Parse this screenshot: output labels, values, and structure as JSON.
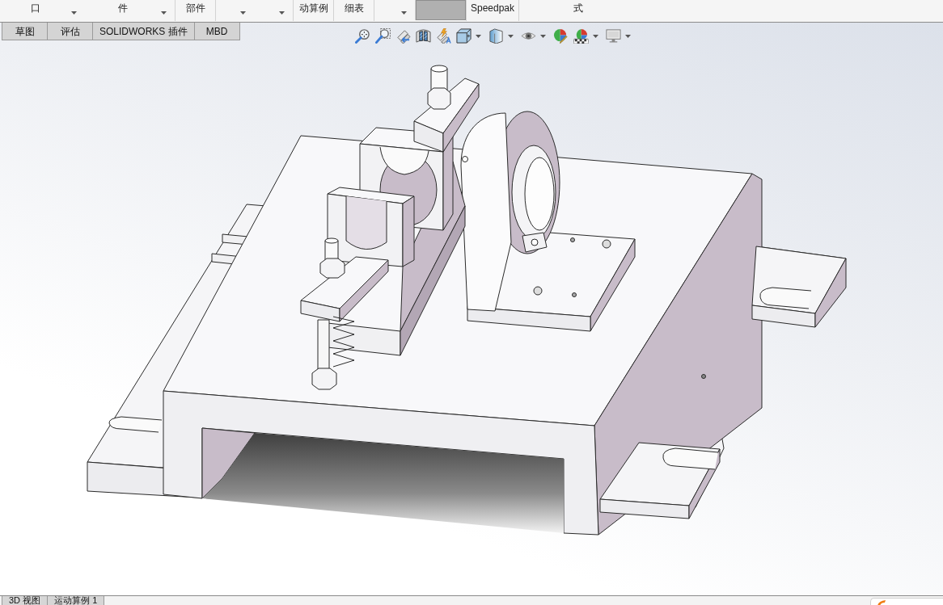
{
  "command_manager": {
    "groups": [
      {
        "items": [
          {
            "kind": "command",
            "label": "口",
            "menu": true
          },
          {
            "kind": "command",
            "label": "件",
            "menu": true
          }
        ]
      },
      {
        "items": [
          {
            "kind": "command",
            "label": "部件"
          }
        ]
      },
      {
        "items": [
          {
            "kind": "command",
            "menu": true
          },
          {
            "kind": "command",
            "menu": true
          }
        ]
      },
      {
        "items": [
          {
            "kind": "command",
            "label": "动算例"
          }
        ]
      },
      {
        "items": [
          {
            "kind": "command",
            "label": "细表"
          }
        ]
      },
      {
        "items": [
          {
            "kind": "command",
            "menu": true
          }
        ]
      },
      {
        "items": [
          {
            "kind": "tile"
          }
        ]
      },
      {
        "items": [
          {
            "kind": "command",
            "label": "Speedpak"
          }
        ]
      },
      {
        "items": [
          {
            "kind": "command",
            "label": "式"
          }
        ]
      }
    ]
  },
  "tabs": [
    {
      "label": "草图",
      "selected": false
    },
    {
      "label": "评估",
      "selected": false
    },
    {
      "label": "SOLIDWORKS 插件",
      "selected": false
    },
    {
      "label": "MBD",
      "selected": false
    }
  ],
  "view_toolbar": {
    "tools": [
      {
        "kind": "zoom_fit"
      },
      {
        "kind": "zoom_area"
      },
      {
        "kind": "previous_view"
      },
      {
        "kind": "section_view"
      },
      {
        "kind": "dynamic_annotation"
      },
      {
        "kind": "view_orientation",
        "menu": true
      },
      {
        "kind": "display_style",
        "menu": true
      },
      {
        "kind": "hide_show",
        "menu": true
      },
      {
        "kind": "edit_appearance"
      },
      {
        "kind": "apply_scene",
        "menu": true
      },
      {
        "kind": "view_settings",
        "menu": true
      }
    ]
  },
  "bottom_tabs": [
    {
      "label": "3D 视图",
      "selected": false
    },
    {
      "label": "运动算例 1",
      "selected": false
    }
  ]
}
